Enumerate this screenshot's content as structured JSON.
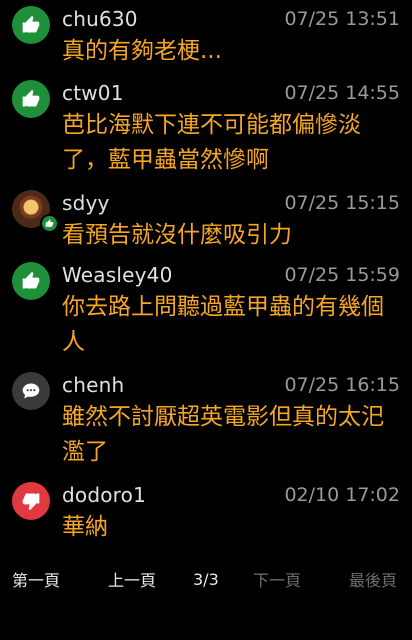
{
  "comments": [
    {
      "user": "chu630",
      "time": "07/25 13:51",
      "text": "真的有夠老梗...",
      "avatar": "thumbs-up",
      "avatar_color": "#1f8f3a"
    },
    {
      "user": "ctw01",
      "time": "07/25 14:55",
      "text": "芭比海默下連不可能都偏慘淡了，藍甲蟲當然慘啊",
      "avatar": "thumbs-up",
      "avatar_color": "#1f8f3a"
    },
    {
      "user": "sdyy",
      "time": "07/25 15:15",
      "text": "看預告就沒什麼吸引力",
      "avatar": "user-photo",
      "avatar_color": "#7a3b1e"
    },
    {
      "user": "Weasley40",
      "time": "07/25 15:59",
      "text": "你去路上問聽過藍甲蟲的有幾個人",
      "avatar": "thumbs-up",
      "avatar_color": "#1f8f3a"
    },
    {
      "user": "chenh",
      "time": "07/25 16:15",
      "text": "雖然不討厭超英電影但真的太汜濫了",
      "avatar": "speech-bubble",
      "avatar_color": "#3a3a3a"
    },
    {
      "user": "dodoro1",
      "time": "02/10 17:02",
      "text": "華納",
      "avatar": "thumbs-down",
      "avatar_color": "#e0393f"
    }
  ],
  "pagination": {
    "first": "第一頁",
    "prev": "上一頁",
    "current": "3/3",
    "next": "下一頁",
    "last": "最後頁"
  }
}
